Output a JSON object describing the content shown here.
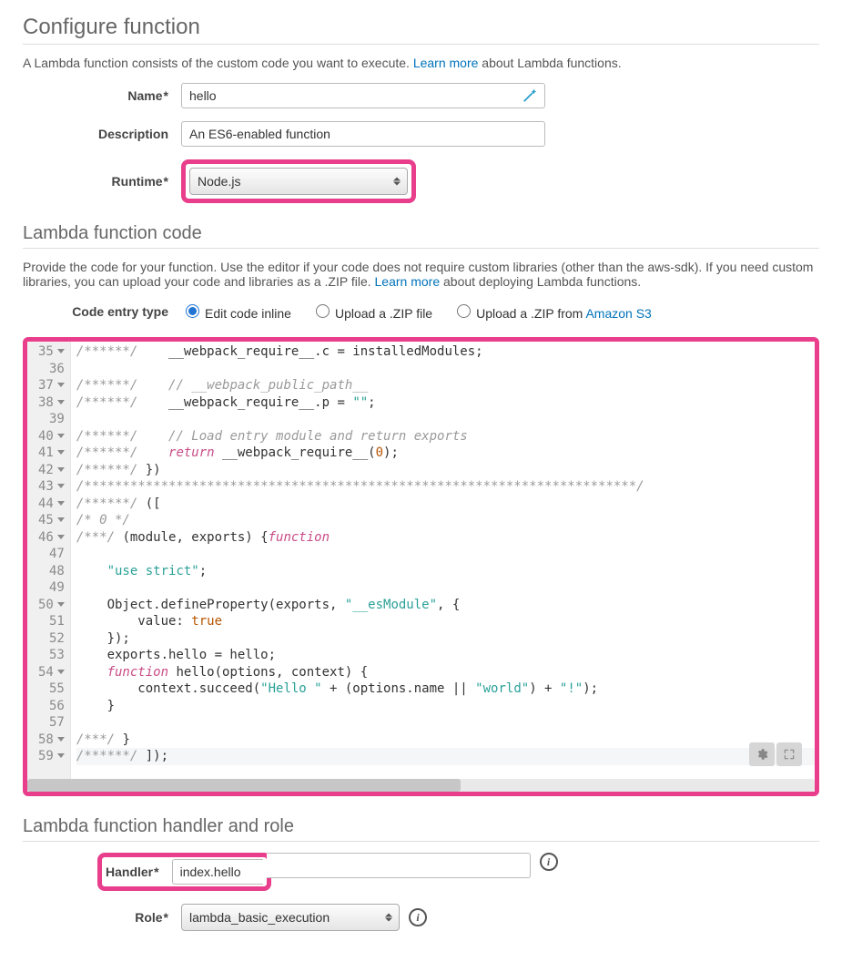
{
  "configure": {
    "title": "Configure function",
    "desc_pre": "A Lambda function consists of the custom code you want to execute. ",
    "link": "Learn more",
    "desc_post": " about Lambda functions.",
    "name_label": "Name",
    "name_value": "hello",
    "desc_label": "Description",
    "desc_value": "An ES6-enabled function",
    "runtime_label": "Runtime",
    "runtime_value": "Node.js"
  },
  "code_section": {
    "title": "Lambda function code",
    "desc_pre": "Provide the code for your function. Use the editor if your code does not require custom libraries (other than the aws-sdk). If you need custom libraries, you can upload your code and libraries as a .ZIP file. ",
    "link": "Learn more",
    "desc_post": " about deploying Lambda functions.",
    "entry_label": "Code entry type",
    "entry_options": {
      "inline": "Edit code inline",
      "zip": "Upload a .ZIP file",
      "s3_pre": "Upload a .ZIP from ",
      "s3_link": "Amazon S3"
    }
  },
  "editor": {
    "line_numbers": [
      "35",
      "36",
      "37",
      "38",
      "39",
      "40",
      "41",
      "42",
      "43",
      "44",
      "45",
      "46",
      "47",
      "48",
      "49",
      "50",
      "51",
      "52",
      "53",
      "54",
      "55",
      "56",
      "57",
      "58",
      "59"
    ],
    "active_line_index": 24,
    "lines": [
      {
        "c": "/******/",
        "rest": "    __webpack_require__.c = installedModules;"
      },
      {
        "plain": ""
      },
      {
        "c": "/******/",
        "cmt": "    // __webpack_public_path__"
      },
      {
        "c": "/******/",
        "rest": "    __webpack_require__.p = ",
        "str": "\"\"",
        "tail": ";"
      },
      {
        "plain": ""
      },
      {
        "c": "/******/",
        "cmt": "    // Load entry module and return exports"
      },
      {
        "c": "/******/",
        "rest": "    ",
        "kw": "return",
        "tail": " __webpack_require__(",
        "num": "0",
        "tail2": ");"
      },
      {
        "c": "/******/",
        "rest": " })"
      },
      {
        "plain": "",
        "cfull": "/************************************************************************/"
      },
      {
        "c": "/******/",
        "rest": " (["
      },
      {
        "plain": "",
        "cfull": "/* 0 */"
      },
      {
        "c": "/***/ ",
        "kw": "function",
        "rest": "(module, exports) {"
      },
      {
        "plain": ""
      },
      {
        "indent": "    ",
        "str": "\"use strict\"",
        "tail": ";"
      },
      {
        "plain": ""
      },
      {
        "indent": "    ",
        "call": "Object",
        "rest": ".defineProperty(exports, ",
        "str": "\"__esModule\"",
        "tail": ", {"
      },
      {
        "indent": "        value: ",
        "num": "true"
      },
      {
        "indent": "    });"
      },
      {
        "indent": "    exports.hello = hello;"
      },
      {
        "indent": "    ",
        "kw": "function",
        "rest": " hello(options, context) {"
      },
      {
        "indent": "        context.succeed(",
        "str": "\"Hello \"",
        "mid": " + (options.name || ",
        "str2": "\"world\"",
        "mid2": ") + ",
        "str3": "\"!\"",
        "tail": ");"
      },
      {
        "indent": "    }"
      },
      {
        "plain": ""
      },
      {
        "c": "/***/",
        "rest": " }"
      },
      {
        "c": "/******/",
        "rest": " ]);"
      }
    ]
  },
  "handler_section": {
    "title": "Lambda function handler and role",
    "handler_label": "Handler",
    "handler_value": "index.hello",
    "role_label": "Role",
    "role_value": "lambda_basic_execution"
  }
}
